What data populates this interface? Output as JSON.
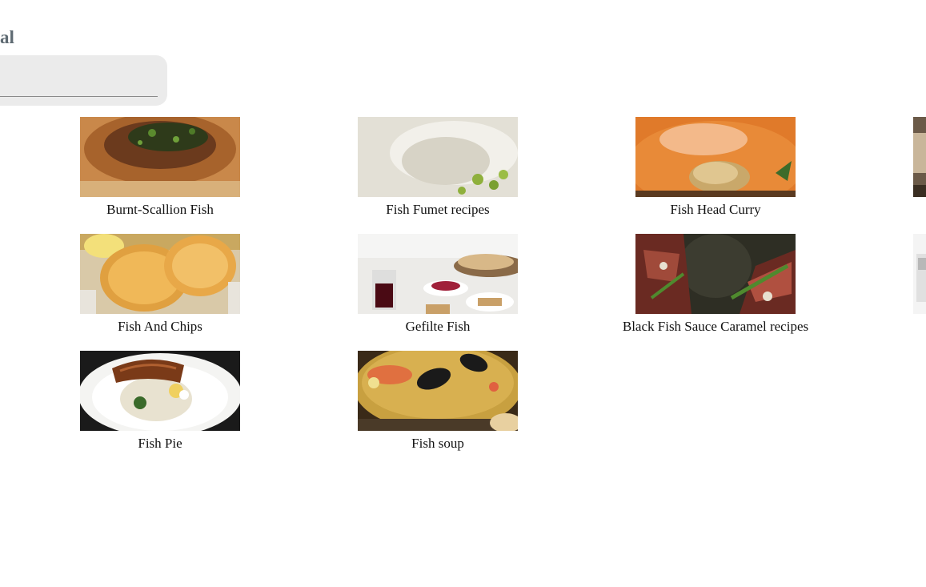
{
  "header": {
    "title_fragment": "al"
  },
  "search": {
    "value": "",
    "placeholder": ""
  },
  "recipes": [
    {
      "label": "Burnt-Scallion Fish",
      "icon": "recipe-photo-icon"
    },
    {
      "label": "Fish Fumet recipes",
      "icon": "recipe-photo-icon"
    },
    {
      "label": "Fish Head Curry",
      "icon": "recipe-photo-icon"
    },
    {
      "label": "Fish And Chips",
      "icon": "recipe-photo-icon"
    },
    {
      "label": "Gefilte Fish",
      "icon": "recipe-photo-icon"
    },
    {
      "label": "Black Fish Sauce Caramel recipes",
      "icon": "recipe-photo-icon"
    },
    {
      "label": "Fish Pie",
      "icon": "recipe-photo-icon"
    },
    {
      "label": "Fish soup",
      "icon": "recipe-photo-icon"
    }
  ],
  "colors": {
    "title": "#5f6b73",
    "search_bg": "#ebebeb",
    "caption": "#111111"
  }
}
